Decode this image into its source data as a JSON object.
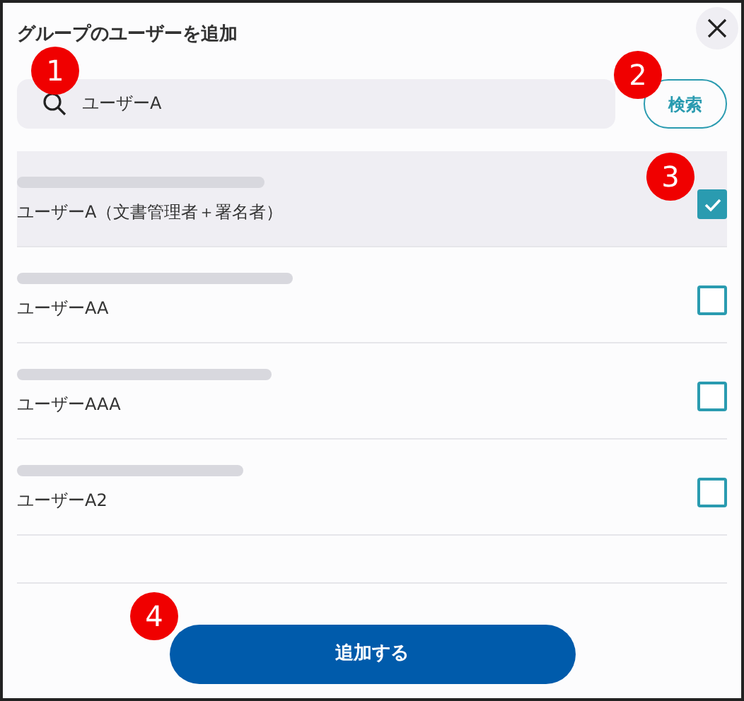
{
  "dialog": {
    "title": "グループのユーザーを追加"
  },
  "search": {
    "value": "ユーザーA",
    "button": "検索"
  },
  "users": [
    {
      "name": "ユーザーA（文書管理者＋署名者）",
      "checked": true
    },
    {
      "name": "ユーザーAA",
      "checked": false
    },
    {
      "name": "ユーザーAAA",
      "checked": false
    },
    {
      "name": "ユーザーA2",
      "checked": false
    }
  ],
  "add_button": "追加する",
  "callouts": [
    {
      "label": "1"
    },
    {
      "label": "2"
    },
    {
      "label": "3"
    },
    {
      "label": "4"
    }
  ]
}
